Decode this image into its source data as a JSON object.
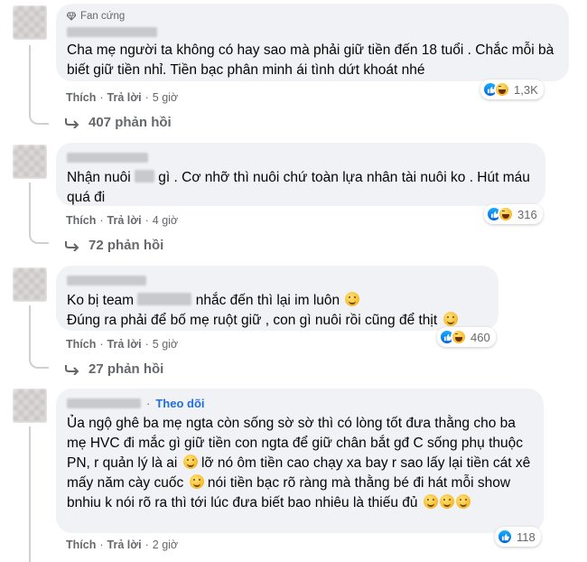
{
  "comments": [
    {
      "badge": "Fan cứng",
      "text": "Cha mẹ người ta không có hay sao mà phải giữ tiền đến 18 tuổi . Chắc mỗi bà biết giữ tiền nhỉ. Tiền bạc phân minh ái tình dứt khoát nhé",
      "like": "Thích",
      "reply": "Trả lời",
      "time": "5 giờ",
      "reaction_count": "1,3K",
      "replies": "407 phản hồi"
    },
    {
      "text_before": "Nhận nuôi",
      "text_after": "gì . Cơ nhỡ thì nuôi chứ toàn lựa nhân tài nuôi ko . Hút máu quá đi",
      "like": "Thích",
      "reply": "Trả lời",
      "time": "4 giờ",
      "reaction_count": "316",
      "replies": "72 phản hồi"
    },
    {
      "line1_before": "Ko bị team",
      "line1_after": "nhắc đến thì lại im luôn",
      "line2": "Đúng ra phải để bố mẹ ruột giữ , con gì nuôi rồi cũng để thịt",
      "like": "Thích",
      "reply": "Trả lời",
      "time": "5 giờ",
      "reaction_count": "460",
      "replies": "27 phản hồi"
    },
    {
      "follow": "Theo dõi",
      "text_part1": "Ủa ngộ ghê ba mẹ ngta còn sống sờ sờ thì có lòng tốt đưa thằng cho ba mẹ HVC đi mắc gì giữ tiền con ngta để giữ chân bắt gđ C sống phụ thuộc PN, r quản lý là ai",
      "text_part2": "lỡ nó ôm tiền cao chạy xa bay r sao lấy lại tiền cát xê mấy năm cày cuốc",
      "text_part3": "nói tiền bạc rõ ràng mà thằng bé đi hát mỗi show bnhiu k nói rõ ra thì tới lúc đưa biết bao nhiêu là thiếu đủ",
      "like": "Thích",
      "reply": "Trả lời",
      "time": "2 giờ",
      "reaction_count": "118"
    }
  ],
  "separator": "·",
  "icons": {
    "badge": "diamond-icon",
    "reply_arrow": "reply-arrow-icon",
    "like": "like-reaction-icon",
    "haha": "haha-reaction-icon"
  },
  "colors": {
    "bubble": "#f0f2f5",
    "meta": "#65676b",
    "link": "#216fdb",
    "like": "#0062df"
  }
}
